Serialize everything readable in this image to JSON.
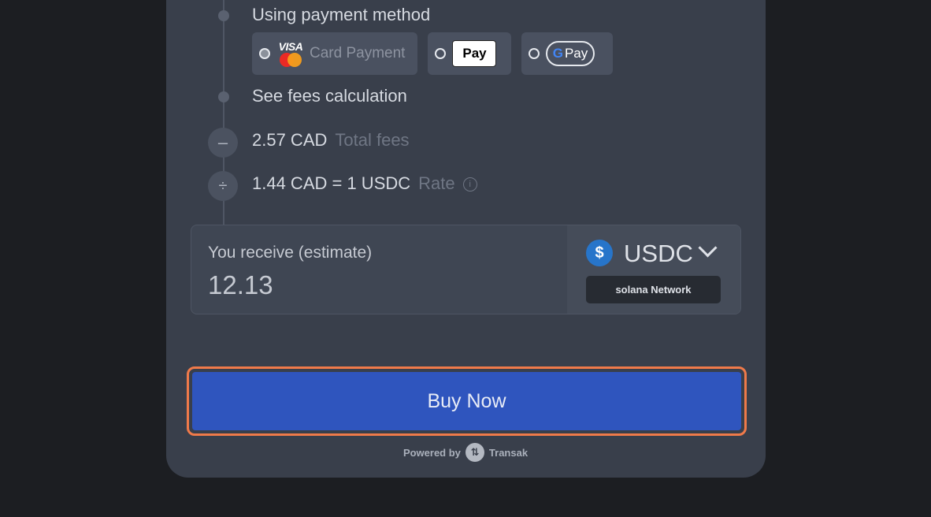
{
  "steps": {
    "payment_method_label": "Using payment method",
    "fees_label": "See fees calculation",
    "total_fees_value": "2.57 CAD",
    "total_fees_label": "Total fees",
    "rate_value": "1.44 CAD = 1 USDC",
    "rate_label": "Rate"
  },
  "payment_options": {
    "card": {
      "visa": "VISA",
      "label": "Card Payment",
      "selected": true
    },
    "apple_pay": {
      "label": "Pay"
    },
    "google_pay": {
      "g": "G",
      "label": "Pay"
    }
  },
  "receive": {
    "label": "You receive (estimate)",
    "amount": "12.13",
    "currency": "USDC",
    "network": "solana Network"
  },
  "buy_button": {
    "label": "Buy Now"
  },
  "footer": {
    "powered_by": "Powered by",
    "brand": "Transak"
  },
  "colors": {
    "accent": "#2f55be",
    "highlight": "#f07a4a",
    "usdc": "#2775ca"
  }
}
